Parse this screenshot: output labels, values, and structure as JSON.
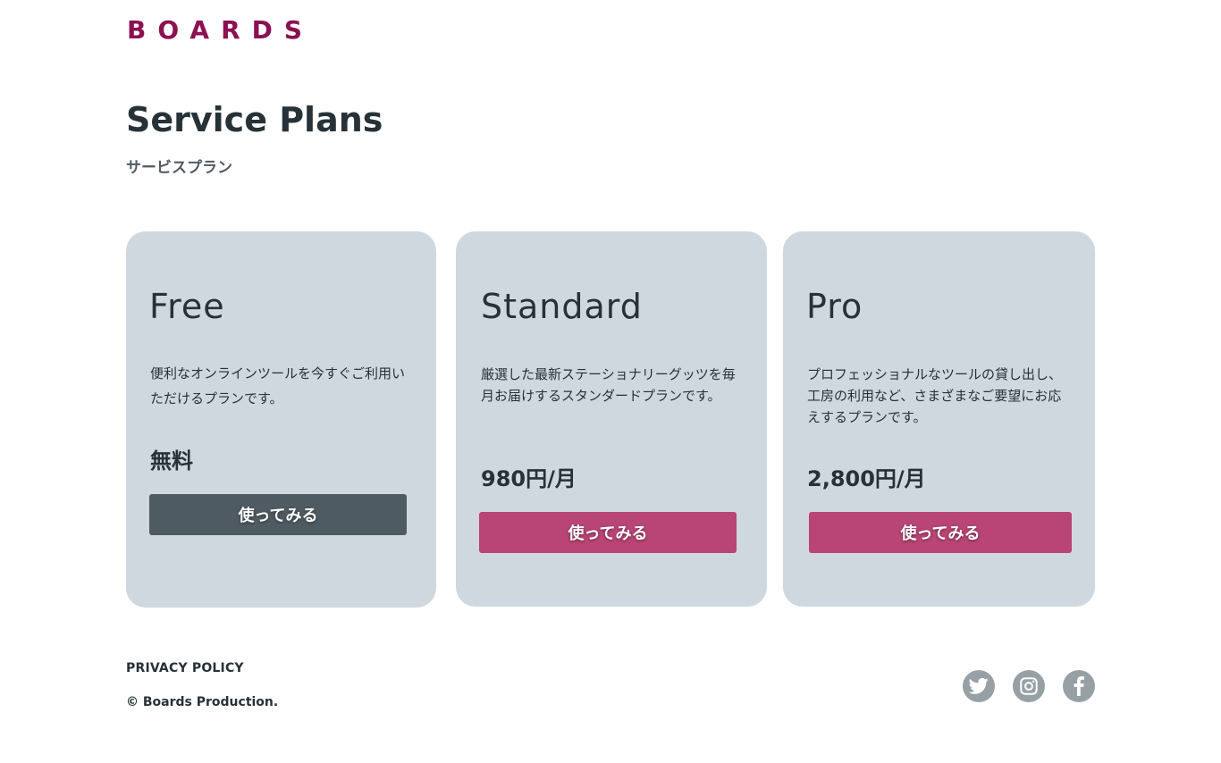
{
  "brand": {
    "logo": "BOARDS"
  },
  "header": {
    "title": "Service Plans",
    "subtitle": "サービスプラン"
  },
  "plans": [
    {
      "name": "Free",
      "description": "便利なオンラインツールを今すぐご利用いただけるプランです。",
      "price": "無料",
      "button": "使ってみる"
    },
    {
      "name": "Standard",
      "description": "厳選した最新ステーショナリーグッツを毎月お届けするスタンダードプランです。",
      "price": "980円/月",
      "button": "使ってみる"
    },
    {
      "name": "Pro",
      "description": "プロフェッショナルなツールの貸し出し、工房の利用など、さまざまなご要望にお応えするプランです。",
      "price": "2,800円/月",
      "button": "使ってみる"
    }
  ],
  "footer": {
    "privacy": "PRIVACY POLICY",
    "copyright": "© Boards Production.",
    "social": [
      "twitter-icon",
      "instagram-icon",
      "facebook-icon"
    ]
  },
  "colors": {
    "brand": "#8b1152",
    "card_bg": "#cfd8de",
    "primary_button": "#b84575",
    "free_button": "#4f5b62",
    "social_icon_bg": "#97a0a5"
  }
}
